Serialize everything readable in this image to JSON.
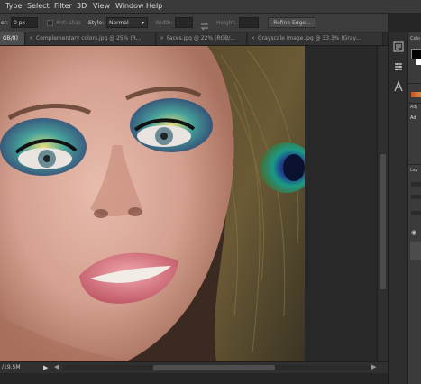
{
  "menu": {
    "items": [
      {
        "label": "Type"
      },
      {
        "label": "Select"
      },
      {
        "label": "Filter"
      },
      {
        "label": "3D"
      },
      {
        "label": "View"
      },
      {
        "label": "Window"
      },
      {
        "label": "Help"
      }
    ]
  },
  "options": {
    "feather_label": "er:",
    "feather_value": "0 px",
    "antialias_label": "Anti-alias",
    "style_label": "Style:",
    "style_value": "Normal",
    "width_label": "Width:",
    "height_label": "Height:",
    "refine_edge": "Refine Edge..."
  },
  "tabs": [
    {
      "label": "GB/8)",
      "active": true
    },
    {
      "label": "Complementary colors.jpg @ 25% (R...",
      "active": false
    },
    {
      "label": "Faces.jpg @ 22% (RGB/...",
      "active": false
    },
    {
      "label": "Grayscale image.jpg @ 33.3% (Gray...",
      "active": false
    }
  ],
  "status": {
    "doc_size": "/19.5M"
  },
  "panels": {
    "color_header": "Colo",
    "adjust_header": "Adj",
    "adjust_sub": "Ad",
    "layers_header": "Lay"
  },
  "icons": {
    "swap_dims": "swap-arrows-icon",
    "status_arrow": "play-right-icon"
  }
}
